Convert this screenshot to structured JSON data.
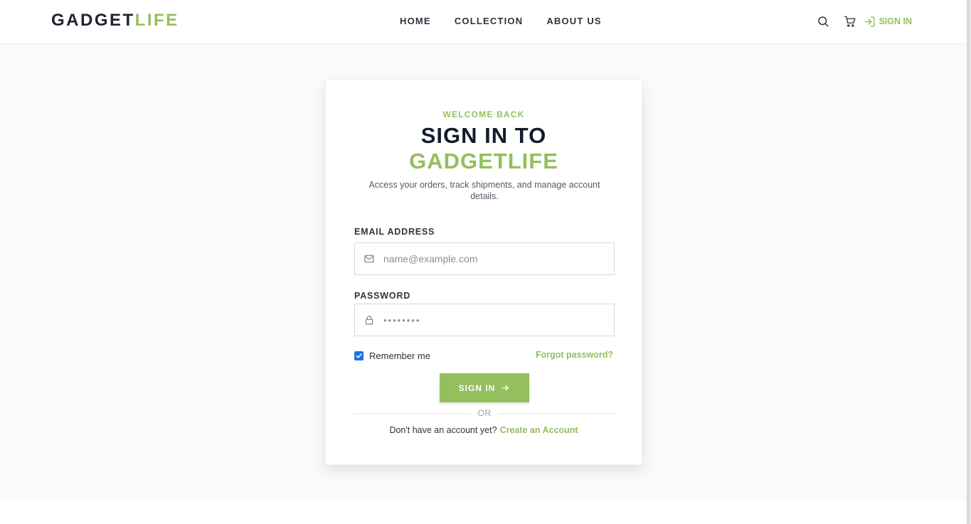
{
  "header": {
    "logo_main": "GADGET",
    "logo_accent": "LIFE",
    "nav": [
      {
        "label": "HOME"
      },
      {
        "label": "COLLECTION"
      },
      {
        "label": "ABOUT US"
      }
    ],
    "signin_label": "SIGN IN",
    "icons": [
      "search-icon",
      "cart-icon",
      "sign-in-icon"
    ]
  },
  "login": {
    "eyebrow": "WELCOME BACK",
    "title_line1": "SIGN IN TO",
    "title_line2": "GADGETLIFE",
    "subtitle": "Access your orders, track shipments, and manage account details.",
    "email_label": "EMAIL ADDRESS",
    "email_placeholder": "name@example.com",
    "password_label": "PASSWORD",
    "password_placeholder": "••••••••",
    "remember_label": "Remember me",
    "remember_checked": true,
    "forgot_label": "Forgot password?",
    "submit_label": "SIGN IN",
    "or_label": "OR",
    "no_account_text": "Don't have an account yet?",
    "create_account_label": "Create an Account"
  },
  "colors": {
    "accent": "#93bf5d",
    "dark": "#141b2b",
    "checkbox": "#1a73e8"
  }
}
